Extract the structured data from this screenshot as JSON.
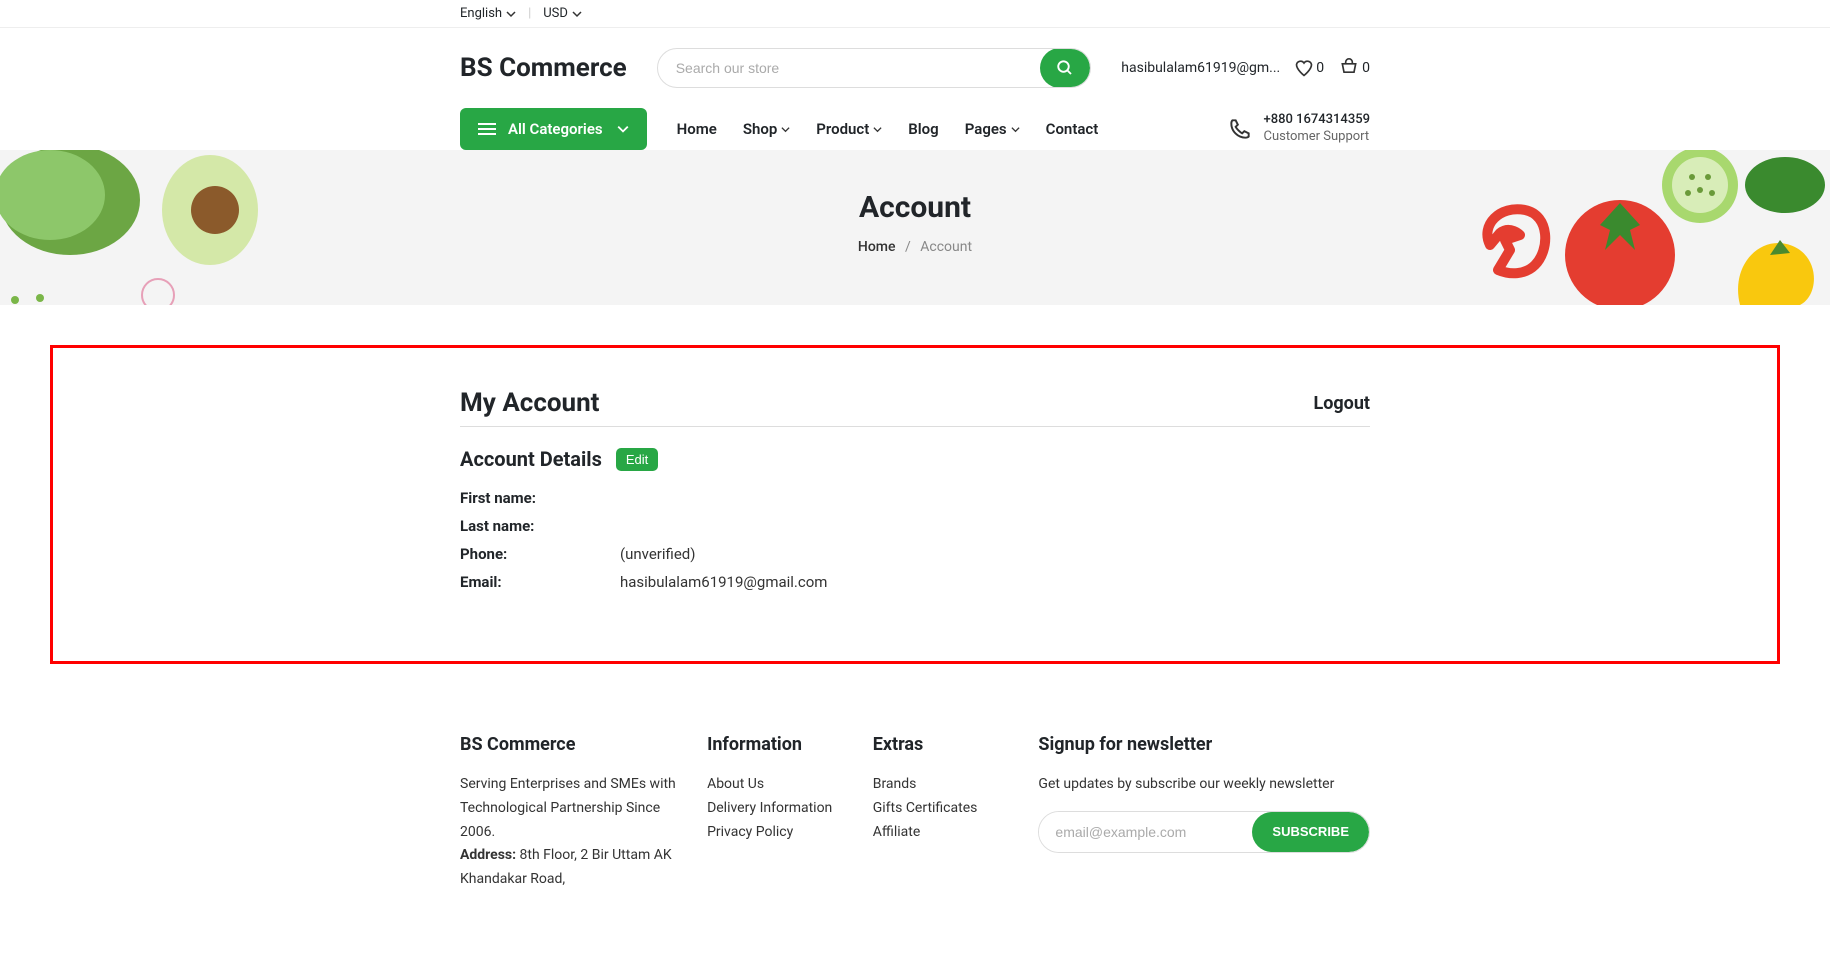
{
  "topbar": {
    "language": "English",
    "currency": "USD"
  },
  "header": {
    "logo": "BS Commerce",
    "search_placeholder": "Search our store",
    "user_email_short": "hasibulalam61919@gm...",
    "wishlist_count": "0",
    "cart_count": "0"
  },
  "nav": {
    "all_categories": "All Categories",
    "links": [
      "Home",
      "Shop",
      "Product",
      "Blog",
      "Pages",
      "Contact"
    ],
    "support_phone": "+880 1674314359",
    "support_label": "Customer Support"
  },
  "banner": {
    "title": "Account",
    "crumb_home": "Home",
    "crumb_current": "Account"
  },
  "account": {
    "heading": "My Account",
    "logout": "Logout",
    "details_heading": "Account Details",
    "edit": "Edit",
    "labels": {
      "first_name": "First name:",
      "last_name": "Last name:",
      "phone": "Phone:",
      "email": "Email:"
    },
    "values": {
      "first_name": "",
      "last_name": "",
      "phone": "(unverified)",
      "email": "hasibulalam61919@gmail.com"
    }
  },
  "footer": {
    "brand": "BS Commerce",
    "tagline": "Serving Enterprises and SMEs with Technological Partnership Since 2006.",
    "address_label": "Address:",
    "address": " 8th Floor, 2 Bir Uttam AK Khandakar Road,",
    "info_heading": "Information",
    "info_links": [
      "About Us",
      "Delivery Information",
      "Privacy Policy"
    ],
    "extras_heading": "Extras",
    "extras_links": [
      "Brands",
      "Gifts Certificates",
      "Affiliate"
    ],
    "newsletter_heading": "Signup for newsletter",
    "newsletter_text": "Get updates by subscribe our weekly newsletter",
    "newsletter_placeholder": "email@example.com",
    "subscribe": "SUBSCRIBE"
  }
}
